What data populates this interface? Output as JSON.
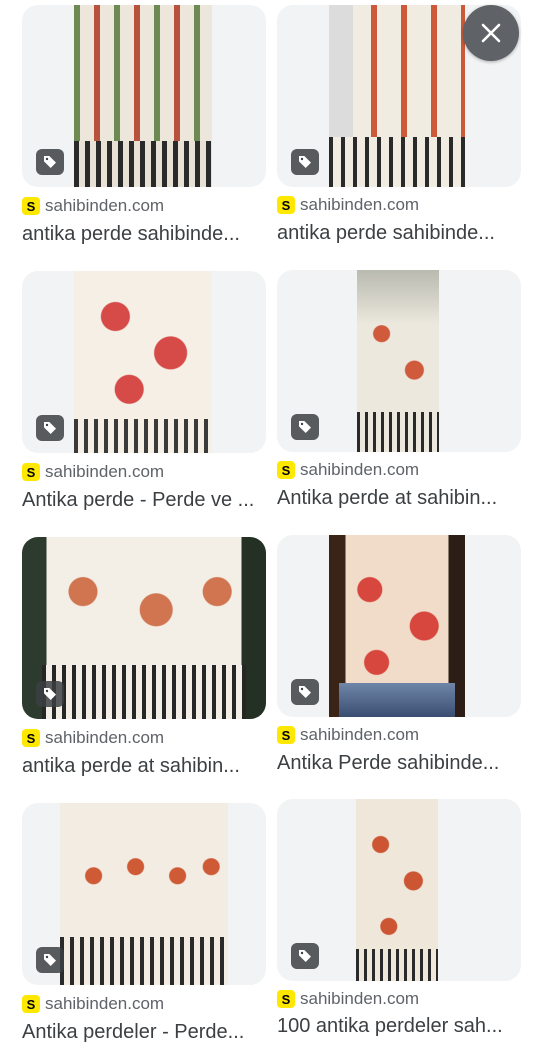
{
  "results": [
    {
      "source": "sahibinden.com",
      "title": "antika perde sahibinde..."
    },
    {
      "source": "sahibinden.com",
      "title": "antika perde sahibinde..."
    },
    {
      "source": "sahibinden.com",
      "title": "Antika perde - Perde ve ..."
    },
    {
      "source": "sahibinden.com",
      "title": "Antika perde at sahibin..."
    },
    {
      "source": "sahibinden.com",
      "title": "antika perde at sahibin..."
    },
    {
      "source": "sahibinden.com",
      "title": "Antika Perde sahibinde..."
    },
    {
      "source": "sahibinden.com",
      "title": "Antika perdeler - Perde..."
    },
    {
      "source": "sahibinden.com",
      "title": "100 antika perdeler sah..."
    }
  ],
  "favicon_letter": "S",
  "icons": {
    "close": "close-icon",
    "tag": "tag-icon"
  },
  "colors": {
    "favicon": "#ffe800",
    "close_bg": "#5f6368",
    "thumb_bg": "#f1f3f4"
  }
}
